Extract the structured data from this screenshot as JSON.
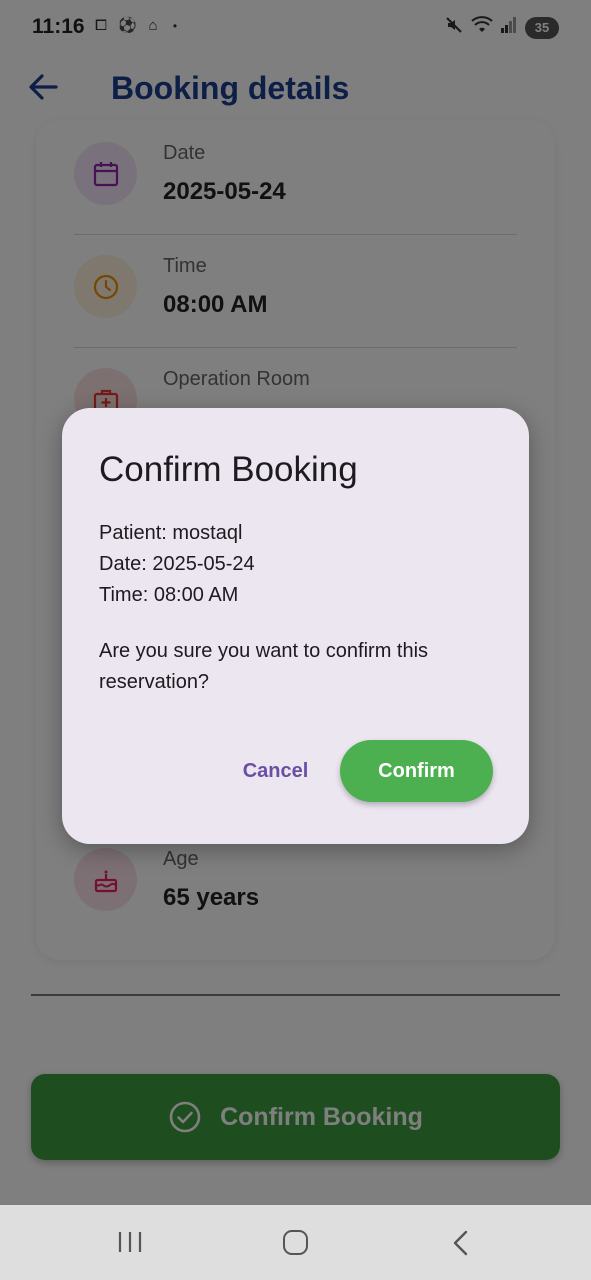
{
  "status_bar": {
    "time": "11:16",
    "battery": "35",
    "icons": [
      "screenshot-icon",
      "football-icon",
      "mosque-icon",
      "dot-icon",
      "mute-icon",
      "wifi-icon",
      "signal-icon",
      "battery-icon"
    ]
  },
  "app_bar": {
    "title": "Booking details",
    "back_icon": "arrow-left-icon"
  },
  "details": {
    "rows": [
      {
        "label": "Date",
        "value": "2025-05-24",
        "icon": "calendar-icon",
        "color": "#8e24aa"
      },
      {
        "label": "Time",
        "value": "08:00 AM",
        "icon": "clock-icon",
        "color": "#ef8f00"
      },
      {
        "label": "Operation Room",
        "value": "",
        "icon": "medical-bag-icon",
        "color": "#e53935"
      },
      {
        "label": "Age",
        "value": "65 years",
        "icon": "cake-icon",
        "color": "#e91e63"
      }
    ]
  },
  "actions": {
    "confirm_booking_label": "Confirm Booking"
  },
  "dialog": {
    "title": "Confirm Booking",
    "patient_line": "Patient: mostaql",
    "date_line": "Date: 2025-05-24",
    "time_line": "Time: 08:00 AM",
    "question": "Are you sure you want to confirm this reservation?",
    "cancel_label": "Cancel",
    "confirm_label": "Confirm"
  },
  "colors": {
    "title": "#1a3d8f",
    "confirm_green": "#4caf50",
    "dialog_bg": "#ece6f1",
    "cancel_text": "#6a4fa3"
  }
}
